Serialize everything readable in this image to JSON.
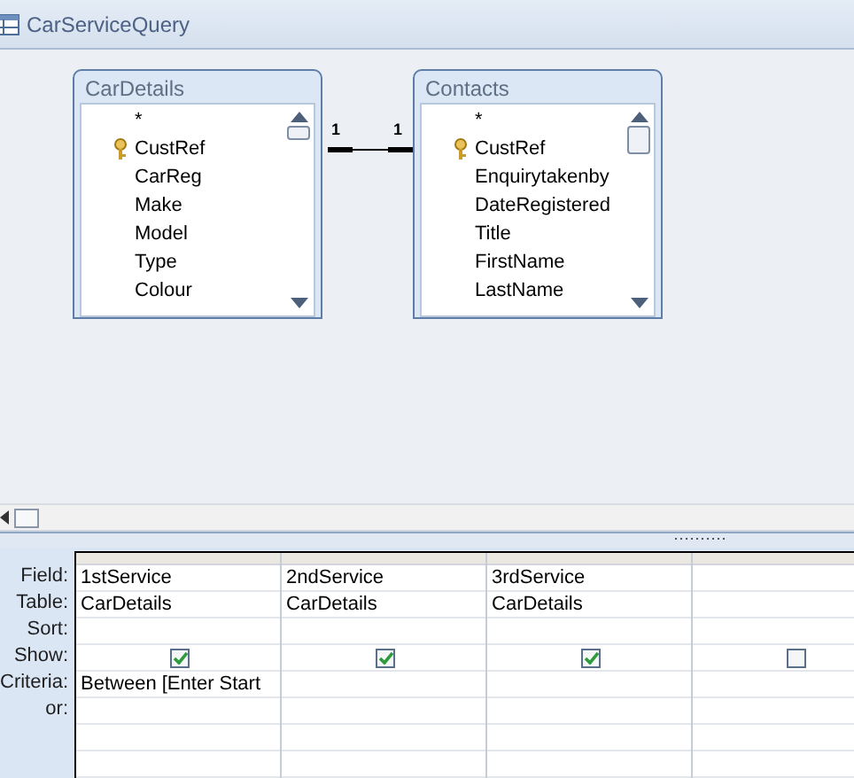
{
  "window": {
    "title": "CarServiceQuery"
  },
  "tables": [
    {
      "title": "CarDetails",
      "fields": [
        {
          "name": "*",
          "key": false
        },
        {
          "name": "CustRef",
          "key": true
        },
        {
          "name": "CarReg",
          "key": false
        },
        {
          "name": "Make",
          "key": false
        },
        {
          "name": "Model",
          "key": false
        },
        {
          "name": "Type",
          "key": false
        },
        {
          "name": "Colour",
          "key": false
        }
      ]
    },
    {
      "title": "Contacts",
      "fields": [
        {
          "name": "*",
          "key": false
        },
        {
          "name": "CustRef",
          "key": true
        },
        {
          "name": "Enquirytakenby",
          "key": false
        },
        {
          "name": "DateRegistered",
          "key": false
        },
        {
          "name": "Title",
          "key": false
        },
        {
          "name": "FirstName",
          "key": false
        },
        {
          "name": "LastName",
          "key": false
        }
      ]
    }
  ],
  "relationship": {
    "left_label": "1",
    "right_label": "1"
  },
  "grid": {
    "row_labels": [
      "Field:",
      "Table:",
      "Sort:",
      "Show:",
      "Criteria:",
      "or:"
    ],
    "columns": [
      {
        "field": "1stService",
        "table": "CarDetails",
        "show": true,
        "criteria": "Between [Enter Start"
      },
      {
        "field": "2ndService",
        "table": "CarDetails",
        "show": true
      },
      {
        "field": "3rdService",
        "table": "CarDetails",
        "show": true
      },
      {
        "show": false
      }
    ]
  }
}
